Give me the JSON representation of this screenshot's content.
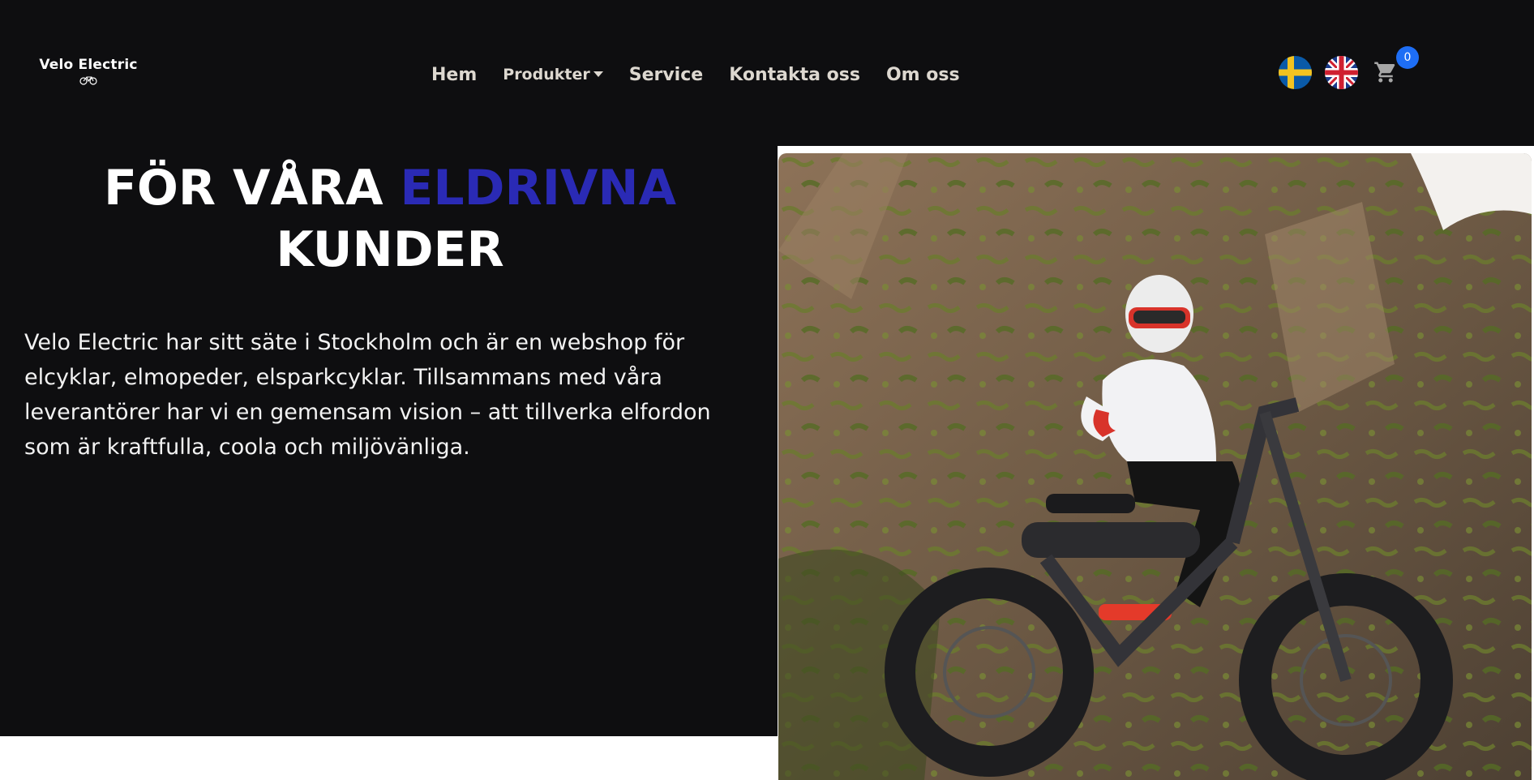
{
  "brand": {
    "name": "Velo Electric"
  },
  "nav": {
    "items": [
      {
        "label": "Hem",
        "has_dropdown": false
      },
      {
        "label": "Produkter",
        "has_dropdown": true
      },
      {
        "label": "Service",
        "has_dropdown": false
      },
      {
        "label": "Kontakta oss",
        "has_dropdown": false
      },
      {
        "label": "Om oss",
        "has_dropdown": false
      }
    ]
  },
  "header": {
    "languages": [
      "swedish-flag-icon",
      "uk-flag-icon"
    ],
    "cart_icon": "shopping-cart-icon",
    "cart_count": "0"
  },
  "hero": {
    "title_part1": "FÖR VÅRA ",
    "title_accent": "ELDRIVNA",
    "title_part2": "KUNDER",
    "body": "Velo Electric har sitt säte i Stockholm och är en webshop för elcyklar, elmopeder, elsparkcyklar. Tillsammans med våra leverantörer har vi en gemensam vision – att tillverka elfordon som är kraftfulla, coola och miljövänliga.",
    "image": "rider-on-electric-bike-by-cliff"
  },
  "colors": {
    "background": "#0e0e10",
    "accent": "#2a2ab5",
    "badge": "#1e6ef5"
  }
}
